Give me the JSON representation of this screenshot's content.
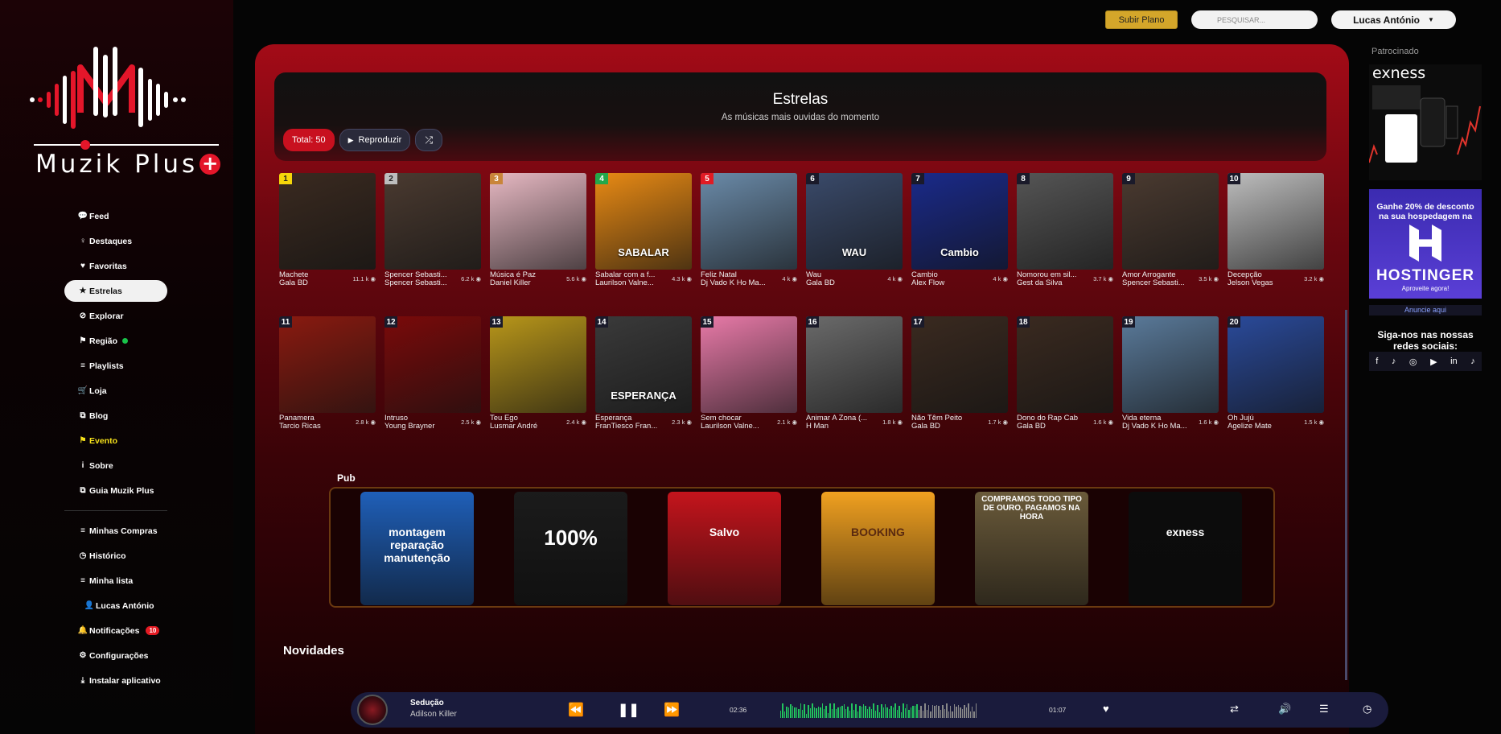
{
  "brand": {
    "name": "Muzik Plus",
    "plus": "+"
  },
  "sidebar": {
    "items": [
      {
        "icon": "💬",
        "label": "Feed"
      },
      {
        "icon": "♀",
        "label": "Destaques"
      },
      {
        "icon": "♥",
        "label": "Favoritas"
      },
      {
        "icon": "★",
        "label": "Estrelas"
      },
      {
        "icon": "⊘",
        "label": "Explorar"
      },
      {
        "icon": "⚑",
        "label": "Região"
      },
      {
        "icon": "≡",
        "label": "Playlists"
      },
      {
        "icon": "🛒",
        "label": "Loja"
      },
      {
        "icon": "⧉",
        "label": "Blog"
      },
      {
        "icon": "⚑",
        "label": "Evento"
      },
      {
        "icon": "i",
        "label": "Sobre"
      },
      {
        "icon": "⧉",
        "label": "Guia Muzik Plus"
      }
    ],
    "items2": [
      {
        "icon": "≡",
        "label": "Minhas Compras"
      },
      {
        "icon": "◷",
        "label": "Histórico"
      },
      {
        "icon": "≡",
        "label": "Minha lista"
      },
      {
        "icon": "👤",
        "label": "Lucas António"
      },
      {
        "icon": "🔔",
        "label": "Notificações",
        "badge": "10"
      },
      {
        "icon": "⚙",
        "label": "Configurações"
      },
      {
        "icon": "⤓",
        "label": "Instalar aplicativo"
      }
    ]
  },
  "topbar": {
    "subscribe": "Subir Plano",
    "search_placeholder": "PESQUISAR...",
    "user": "Lucas António"
  },
  "hero": {
    "title": "Estrelas",
    "subtitle": "As músicas mais ouvidas do momento",
    "total": "Total: 50",
    "play": "Reproduzir"
  },
  "tracks": [
    {
      "rank": "1",
      "title": "Machete",
      "artist": "Gala BD",
      "plays": "11.1 k",
      "rank_color": "#f5d60a",
      "bg": "#3a2a20",
      "cap": ""
    },
    {
      "rank": "2",
      "title": "Spencer Sebasti...",
      "artist": "Spencer Sebasti...",
      "plays": "6.2 k",
      "rank_color": "#bdbdbd",
      "bg": "#4a3a30",
      "cap": ""
    },
    {
      "rank": "3",
      "title": "Música é Paz",
      "artist": "Daniel Killer",
      "plays": "5.6 k",
      "rank_color": "#c9853a",
      "bg": "#e6b8c2",
      "cap": ""
    },
    {
      "rank": "4",
      "title": "Sabalar com a f...",
      "artist": "Laurilson Valne...",
      "plays": "4.3 k",
      "rank_color": "#23a84a",
      "bg": "#e88a14",
      "cap": "SABALAR"
    },
    {
      "rank": "5",
      "title": "Feliz Natal",
      "artist": "Dj Vado K Ho Ma...",
      "plays": "4 k",
      "rank_color": "#e01b24",
      "bg": "#6a8aa8",
      "cap": ""
    },
    {
      "rank": "6",
      "title": "Wau",
      "artist": "Gala BD",
      "plays": "4 k",
      "rank_color": "#1a1a2a",
      "bg": "#3a4a6a",
      "cap": "WAU"
    },
    {
      "rank": "7",
      "title": "Cambio",
      "artist": "Alex Flow",
      "plays": "4 k",
      "rank_color": "#1a1a2a",
      "bg": "#1a2a8a",
      "cap": "Cambio"
    },
    {
      "rank": "8",
      "title": "Nomorou em sil...",
      "artist": "Gest da Silva",
      "plays": "3.7 k",
      "rank_color": "#1a1a2a",
      "bg": "#555",
      "cap": ""
    },
    {
      "rank": "9",
      "title": "Amor Arrogante",
      "artist": "Spencer Sebasti...",
      "plays": "3.5 k",
      "rank_color": "#1a1a2a",
      "bg": "#4a3a30",
      "cap": ""
    },
    {
      "rank": "10",
      "title": "Decepção",
      "artist": "Jelson Vegas",
      "plays": "3.2 k",
      "rank_color": "#1a1a2a",
      "bg": "#bdbdbd",
      "cap": ""
    },
    {
      "rank": "11",
      "title": "Panamera",
      "artist": "Tarcio Ricas",
      "plays": "2.8 k",
      "rank_color": "#1a1a2a",
      "bg": "#8a1a10",
      "cap": ""
    },
    {
      "rank": "12",
      "title": "Intruso",
      "artist": "Young Brayner",
      "plays": "2.5 k",
      "rank_color": "#1a1a2a",
      "bg": "#7a0a0a",
      "cap": ""
    },
    {
      "rank": "13",
      "title": "Teu Ego",
      "artist": "Lusmar André",
      "plays": "2.4 k",
      "rank_color": "#1a1a2a",
      "bg": "#b8961a",
      "cap": ""
    },
    {
      "rank": "14",
      "title": "Esperança",
      "artist": "FranTiesco Fran...",
      "plays": "2.3 k",
      "rank_color": "#1a1a2a",
      "bg": "#3a3a3a",
      "cap": "ESPERANÇA"
    },
    {
      "rank": "15",
      "title": "Sem chocar",
      "artist": "Laurilson Valne...",
      "plays": "2.1 k",
      "rank_color": "#1a1a2a",
      "bg": "#e87aa8",
      "cap": ""
    },
    {
      "rank": "16",
      "title": "Animar A Zona (...",
      "artist": "H Man",
      "plays": "1.8 k",
      "rank_color": "#1a1a2a",
      "bg": "#6a6a6a",
      "cap": ""
    },
    {
      "rank": "17",
      "title": "Não Têm Peito",
      "artist": "Gala BD",
      "plays": "1.7 k",
      "rank_color": "#1a1a2a",
      "bg": "#3a2a20",
      "cap": ""
    },
    {
      "rank": "18",
      "title": "Dono do Rap Cab",
      "artist": "Gala BD",
      "plays": "1.6 k",
      "rank_color": "#1a1a2a",
      "bg": "#3a2a20",
      "cap": ""
    },
    {
      "rank": "19",
      "title": "Vida eterna",
      "artist": "Dj Vado K Ho Ma...",
      "plays": "1.6 k",
      "rank_color": "#1a1a2a",
      "bg": "#5a7a9a",
      "cap": ""
    },
    {
      "rank": "20",
      "title": "Oh Jujú",
      "artist": "Agelize Mate",
      "plays": "1.5 k",
      "rank_color": "#1a1a2a",
      "bg": "#2a4a9a",
      "cap": ""
    }
  ],
  "pub": {
    "label": "Pub",
    "ads": [
      {
        "bg": "#1f5fb8",
        "text": "montagem reparação manutenção"
      },
      {
        "bg": "#1b1b1b",
        "text": "100%"
      },
      {
        "bg": "#c4141c",
        "text": "Salvo"
      },
      {
        "bg": "#f0a020",
        "text": "BOOKING"
      },
      {
        "bg": "#6a5a3a",
        "text": "COMPRAMOS TODO TIPO DE OURO, PAGAMOS NA HORA"
      },
      {
        "bg": "#0c0c0c",
        "text": "exness"
      }
    ]
  },
  "section_next": "Novidades",
  "right": {
    "sponsored": "Patrocinado",
    "exness": "exness",
    "hostinger_promo": "Ganhe 20% de desconto na sua hospedagem na",
    "hostinger": "HOSTINGER",
    "hostinger_cta": "Aproveite agora!",
    "anuncie": "Anuncie aqui",
    "follow": "Siga-nos nas nossas redes sociais:",
    "social_icons": [
      "facebook-icon",
      "tiktok-icon",
      "instagram-icon",
      "youtube-icon",
      "linkedin-icon",
      "tiktok-icon"
    ]
  },
  "player": {
    "title": "Sedução",
    "artist": "Adilson Killer",
    "elapsed": "02:36",
    "remaining": "01:07",
    "progress": 0.7
  },
  "colors": {
    "accent": "#c8101f",
    "gold": "#d4a62a",
    "player_bg": "#1a1b3c"
  }
}
